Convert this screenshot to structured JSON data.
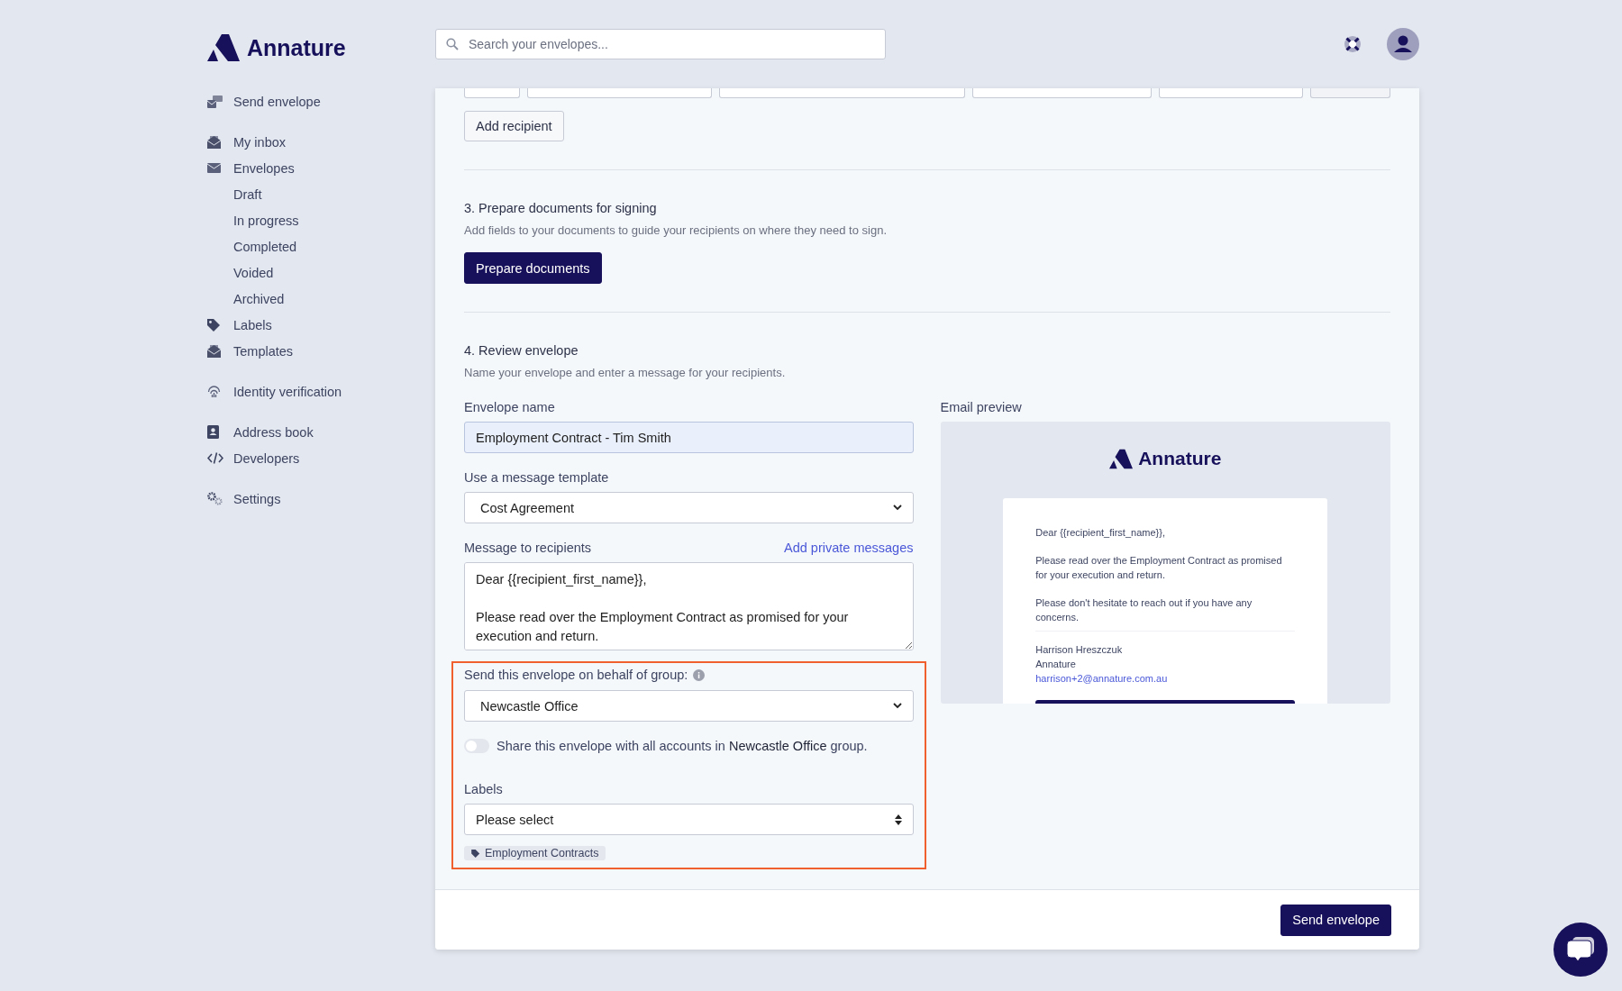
{
  "brand": {
    "name": "Annature"
  },
  "search": {
    "placeholder": "Search your envelopes..."
  },
  "sidebar": {
    "sections": [
      {
        "items": [
          {
            "label": "Send envelope"
          }
        ]
      },
      {
        "items": [
          {
            "label": "My inbox"
          },
          {
            "label": "Envelopes",
            "children": [
              {
                "label": "Draft"
              },
              {
                "label": "In progress"
              },
              {
                "label": "Completed"
              },
              {
                "label": "Voided"
              },
              {
                "label": "Archived"
              }
            ]
          },
          {
            "label": "Labels"
          },
          {
            "label": "Templates"
          }
        ]
      },
      {
        "items": [
          {
            "label": "Identity verification"
          }
        ]
      },
      {
        "items": [
          {
            "label": "Address book"
          },
          {
            "label": "Developers"
          }
        ]
      },
      {
        "items": [
          {
            "label": "Settings"
          }
        ]
      }
    ]
  },
  "recipients": {
    "add_button": "Add recipient"
  },
  "prepare": {
    "title": "3. Prepare documents for signing",
    "subtitle": "Add fields to your documents to guide your recipients on where they need to sign.",
    "button": "Prepare documents"
  },
  "review": {
    "title": "4. Review envelope",
    "subtitle": "Name your envelope and enter a message for your recipients.",
    "envelope_name": {
      "label": "Envelope name",
      "value": "Employment Contract - Tim Smith"
    },
    "template": {
      "label": "Use a message template",
      "value": "Cost Agreement"
    },
    "message": {
      "label": "Message to recipients",
      "link": "Add private messages",
      "value": "Dear {{recipient_first_name}},\n\nPlease read over the Employment Contract as promised for your execution and return."
    },
    "group": {
      "label": "Send this envelope on behalf of group:",
      "value": "Newcastle Office"
    },
    "share": {
      "on": false,
      "text": "Share this envelope with all accounts in **Newcastle Office** group."
    },
    "labels": {
      "label": "Labels",
      "placeholder": "Please select",
      "tags": [
        "Employment Contracts"
      ]
    }
  },
  "email_preview": {
    "label": "Email preview",
    "brand": "Annature",
    "paragraphs": [
      "Dear {{recipient_first_name}},",
      "Please read over the Employment Contract as promised for your execution and return.",
      "Please don't hesitate to reach out if you have any concerns."
    ],
    "signature": [
      "Harrison Hreszczuk",
      "Annature"
    ],
    "email": "harrison+2@annature.com.au"
  },
  "footer": {
    "send_button": "Send envelope"
  }
}
